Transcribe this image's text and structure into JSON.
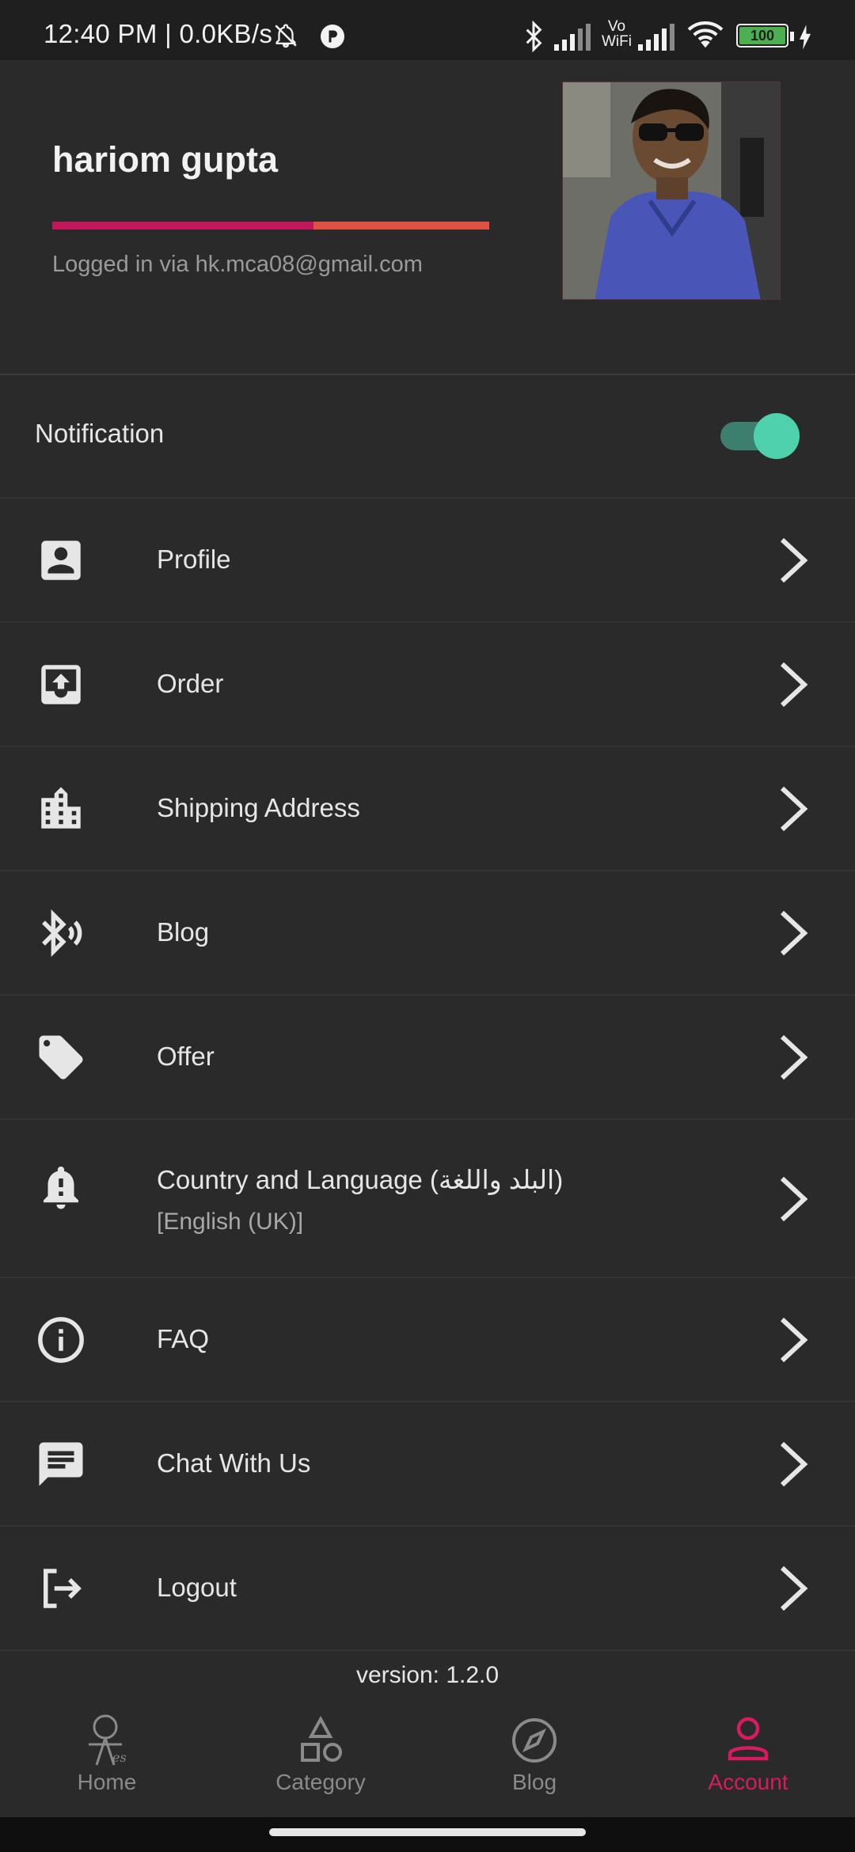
{
  "status_bar": {
    "time": "12:40 PM | 0.0KB/s",
    "network_label": "Vo WiFi",
    "battery": "100"
  },
  "user": {
    "name": "hariom gupta",
    "login_info": "Logged in via hk.mca08@gmail.com",
    "accent_colors": [
      "#c2185b",
      "#e05045"
    ]
  },
  "notification": {
    "label": "Notification",
    "enabled": true,
    "toggle_color": "#4fd1ae"
  },
  "menu": {
    "profile": {
      "label": "Profile",
      "icon": "account-box-icon"
    },
    "order": {
      "label": "Order",
      "icon": "inbox-upload-icon"
    },
    "shipping": {
      "label": "Shipping Address",
      "icon": "building-icon"
    },
    "blog": {
      "label": "Blog",
      "icon": "bluetooth-audio-icon"
    },
    "offer": {
      "label": "Offer",
      "icon": "tag-icon"
    },
    "country": {
      "label": "Country and Language (البلد واللغة)",
      "sub": "[English (UK)]",
      "icon": "bell-alert-icon"
    },
    "faq": {
      "label": "FAQ",
      "icon": "info-icon"
    },
    "chat": {
      "label": "Chat With Us",
      "icon": "chat-icon"
    },
    "logout": {
      "label": "Logout",
      "icon": "logout-icon"
    }
  },
  "version": "version: 1.2.0",
  "bottom_nav": {
    "home": "Home",
    "category": "Category",
    "blog": "Blog",
    "account": "Account",
    "active": "account",
    "active_color": "#d81b60"
  }
}
